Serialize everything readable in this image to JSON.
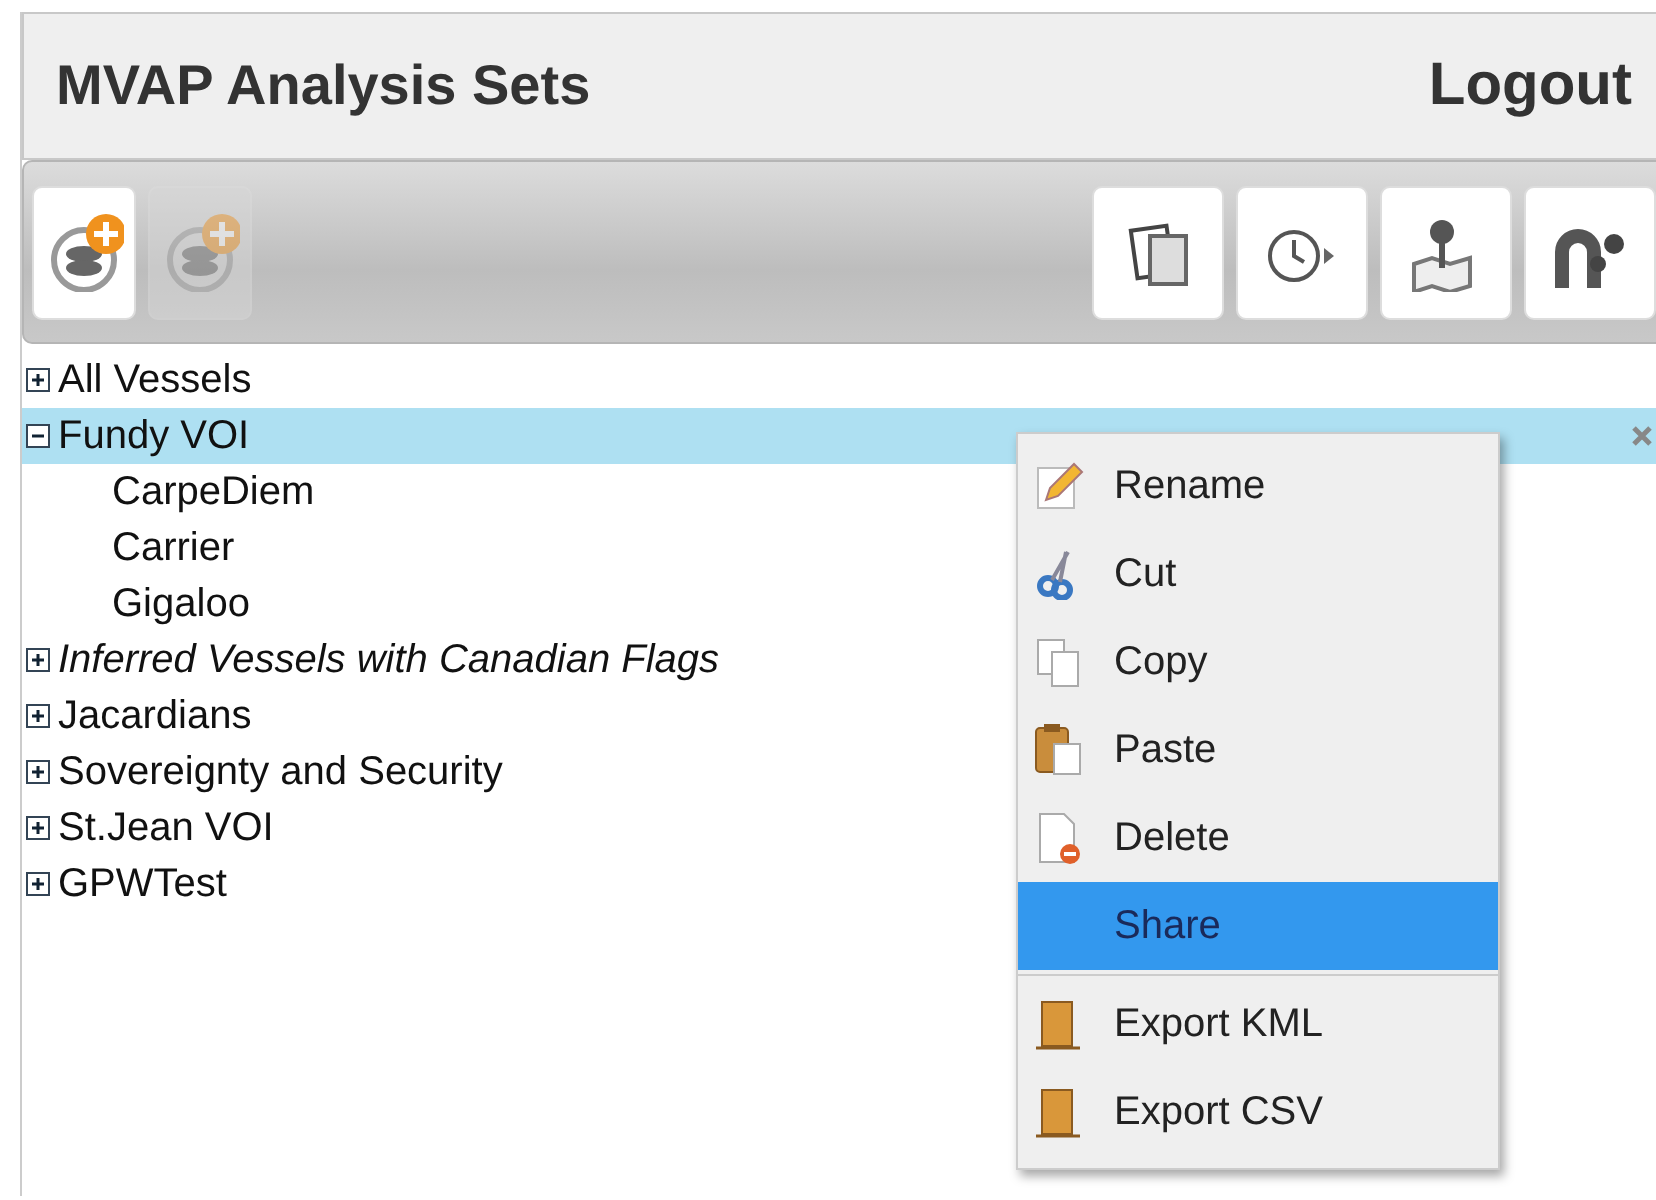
{
  "header": {
    "title": "MVAP Analysis Sets",
    "logout": "Logout"
  },
  "toolbar": {
    "left": [
      {
        "kind": "add-layer",
        "disabled": false
      },
      {
        "kind": "add-layer",
        "disabled": true
      }
    ],
    "right": [
      {
        "kind": "pages",
        "disabled": false
      },
      {
        "kind": "clock",
        "disabled": false
      },
      {
        "kind": "map",
        "disabled": false
      },
      {
        "kind": "path",
        "disabled": false
      }
    ]
  },
  "tree": [
    {
      "label": "All Vessels",
      "expanded": false,
      "selected": false,
      "italic": false
    },
    {
      "label": "Fundy VOI",
      "expanded": true,
      "selected": true,
      "italic": false,
      "children": [
        {
          "label": "CarpeDiem"
        },
        {
          "label": "Carrier"
        },
        {
          "label": "Gigaloo"
        }
      ]
    },
    {
      "label": "Inferred Vessels with Canadian Flags",
      "expanded": false,
      "selected": false,
      "italic": true
    },
    {
      "label": "Jacardians",
      "expanded": false,
      "selected": false,
      "italic": false
    },
    {
      "label": "Sovereignty and Security",
      "expanded": false,
      "selected": false,
      "italic": false
    },
    {
      "label": "St.Jean VOI",
      "expanded": false,
      "selected": false,
      "italic": false
    },
    {
      "label": "GPWTest",
      "expanded": false,
      "selected": false,
      "italic": false
    }
  ],
  "context_menu": {
    "groups": [
      [
        {
          "label": "Rename",
          "kind": "rename",
          "selected": false
        },
        {
          "label": "Cut",
          "kind": "cut",
          "selected": false
        },
        {
          "label": "Copy",
          "kind": "copy",
          "selected": false
        },
        {
          "label": "Paste",
          "kind": "paste",
          "selected": false
        },
        {
          "label": "Delete",
          "kind": "delete",
          "selected": false
        },
        {
          "label": "Share",
          "kind": "plain",
          "selected": true
        }
      ],
      [
        {
          "label": "Export KML",
          "kind": "export",
          "selected": false
        },
        {
          "label": "Export CSV",
          "kind": "export",
          "selected": false
        }
      ]
    ]
  }
}
